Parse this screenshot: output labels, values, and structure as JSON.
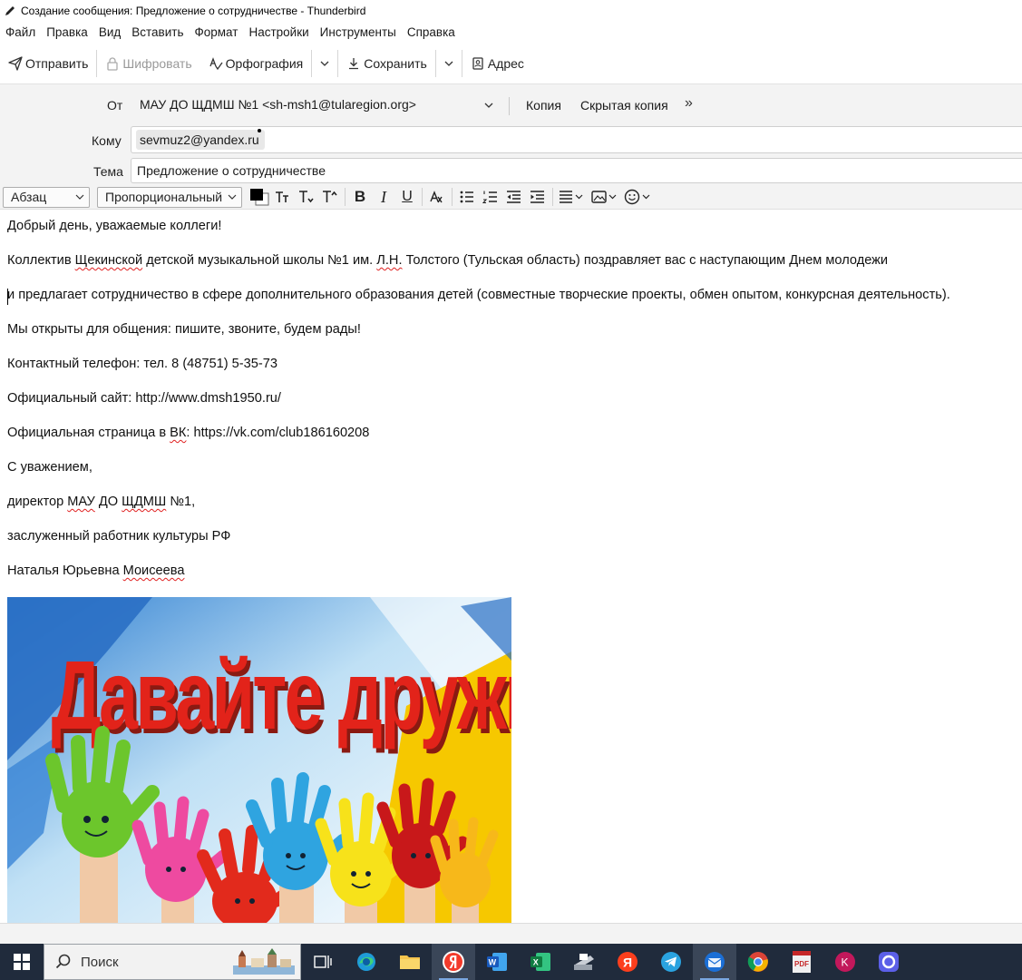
{
  "window": {
    "title": "Создание сообщения: Предложение о сотрудничестве - Thunderbird"
  },
  "menu": {
    "items": [
      {
        "label": "Файл",
        "name": "file"
      },
      {
        "label": "Правка",
        "name": "edit"
      },
      {
        "label": "Вид",
        "name": "view"
      },
      {
        "label": "Вставить",
        "name": "insert"
      },
      {
        "label": "Формат",
        "name": "format"
      },
      {
        "label": "Настройки",
        "name": "options"
      },
      {
        "label": "Инструменты",
        "name": "tools"
      },
      {
        "label": "Справка",
        "name": "help"
      }
    ]
  },
  "toolbar": {
    "send_label": "Отправить",
    "encrypt_label": "Шифровать",
    "spelling_label": "Орфография",
    "save_label": "Сохранить",
    "address_label": "Адрес"
  },
  "headers": {
    "from_label": "От",
    "from_value": "МАУ ДО ЩДМШ №1 <sh-msh1@tularegion.org>",
    "cc_label": "Копия",
    "bcc_label": "Скрытая копия",
    "more_label": "»",
    "to_label": "Кому",
    "to_recipient": "sevmuz2@yandex.ru",
    "subject_label": "Тема",
    "subject_value": "Предложение о сотрудничестве"
  },
  "format": {
    "paragraph_style": "Абзац",
    "font": "Пропорциональный",
    "text_color": "#000000",
    "background_color": "#ffffff"
  },
  "body": {
    "greeting": "Добрый день, уважаемые коллеги!",
    "p1_a": "Коллектив ",
    "p1_b": "Щекинской",
    "p1_c": " детской музыкальной школы №1 им. ",
    "p1_d": "Л.Н.",
    "p1_e": " Толстого (Тульская область) поздравляет вас с наступающим Днем молодежи",
    "p2": "и предлагает сотрудничество в сфере дополнительного образования детей (совместные творческие проекты, обмен опытом, конкурсная деятельность).",
    "p3": "Мы открыты для общения: пишите, звоните, будем рады!",
    "phone": "Контактный телефон: тел. 8 (48751) 5-35-73",
    "site": "Официальный сайт: http://www.dmsh1950.ru/",
    "vk_a": "Официальная страница в ",
    "vk_b": "ВК",
    "vk_c": ": https://vk.com/club186160208",
    "regards": "С уважением,",
    "sig1_a": "директор ",
    "sig1_b": "МАУ",
    "sig1_c": " ДО ",
    "sig1_d": "ЩДМШ",
    "sig1_e": " №1,",
    "sig2": "заслуженный работник культуры РФ",
    "sig3_a": "Наталья Юрьевна ",
    "sig3_b": "Моисеева",
    "image_caption": "Давайте  дружить !"
  },
  "taskbar": {
    "search_placeholder": "Поиск",
    "apps": [
      "task-view",
      "edge",
      "explorer",
      "yandex-browser",
      "word",
      "excel",
      "scanner",
      "yandex",
      "telegram",
      "thunderbird",
      "chrome",
      "pdf",
      "k-app",
      "meeting"
    ]
  }
}
